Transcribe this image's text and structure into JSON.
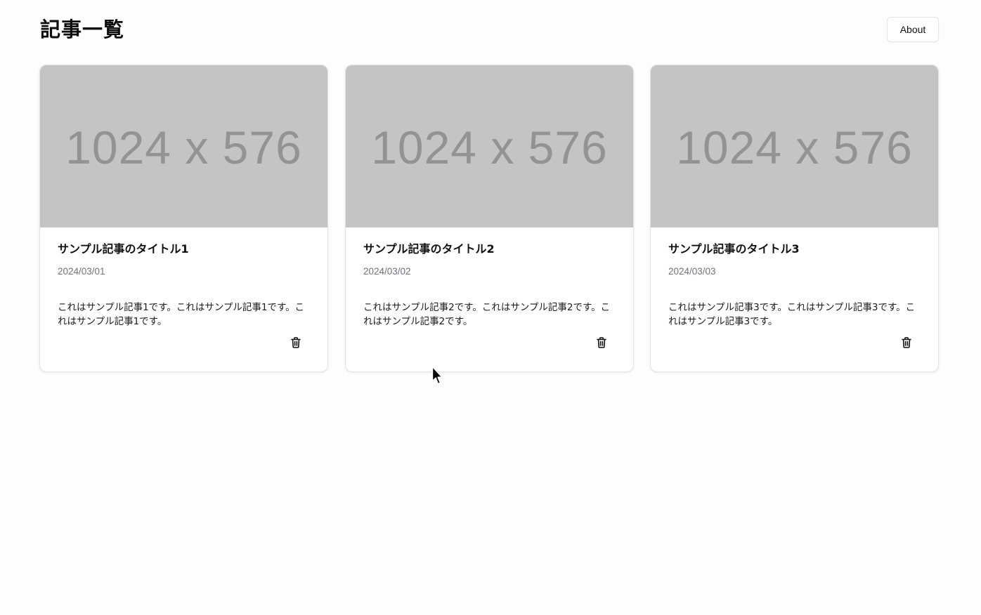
{
  "header": {
    "title": "記事一覧",
    "about_label": "About"
  },
  "articles": [
    {
      "thumbnail_text": "1024 x 576",
      "title": "サンプル記事のタイトル1",
      "date": "2024/03/01",
      "body": "これはサンプル記事1です。これはサンプル記事1です。これはサンプル記事1です。",
      "delete_icon": "trash-icon"
    },
    {
      "thumbnail_text": "1024 x 576",
      "title": "サンプル記事のタイトル2",
      "date": "2024/03/02",
      "body": "これはサンプル記事2です。これはサンプル記事2です。これはサンプル記事2です。",
      "delete_icon": "trash-icon"
    },
    {
      "thumbnail_text": "1024 x 576",
      "title": "サンプル記事のタイトル3",
      "date": "2024/03/03",
      "body": "これはサンプル記事3です。これはサンプル記事3です。これはサンプル記事3です。",
      "delete_icon": "trash-icon"
    }
  ],
  "colors": {
    "background": "#fdfdfd",
    "card_background": "#ffffff",
    "thumbnail_background": "#c4c4c4",
    "thumbnail_text": "#939393",
    "date_text": "#6b7280",
    "border": "#e2e4ea"
  }
}
